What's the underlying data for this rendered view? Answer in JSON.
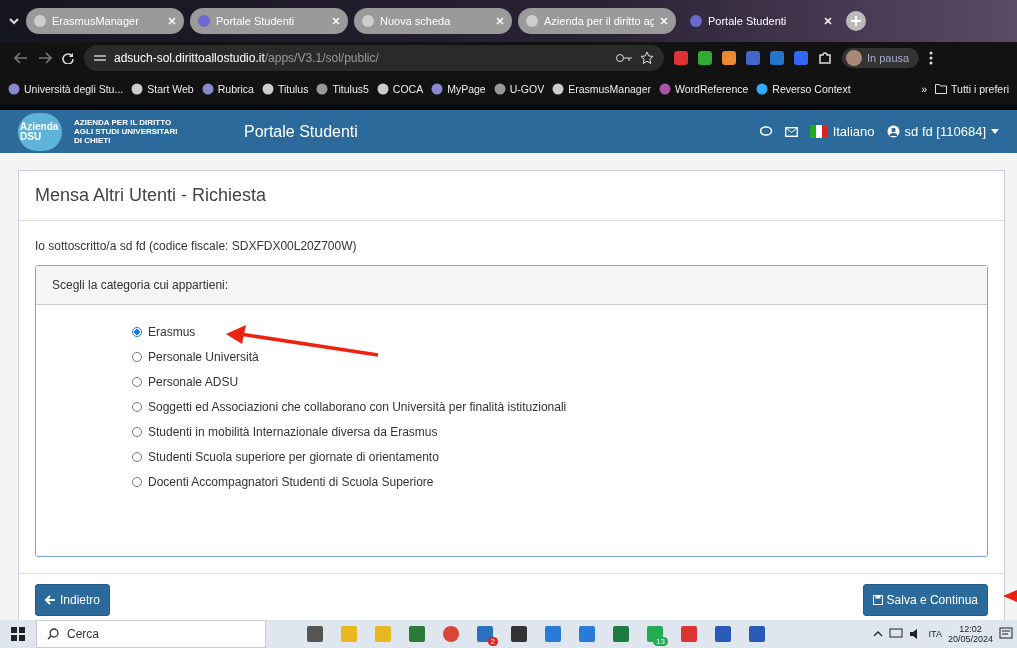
{
  "browser": {
    "tabs": [
      {
        "title": "ErasmusManager",
        "selected": false
      },
      {
        "title": "Portale Studenti",
        "selected": false
      },
      {
        "title": "Nuova scheda",
        "selected": false
      },
      {
        "title": "Azienda per il diritto ag",
        "selected": false
      },
      {
        "title": "Portale Studenti",
        "selected": true
      }
    ],
    "address": {
      "host": "adsuch-sol.dirittoallostudio.it",
      "path": "/apps/V3.1/sol/public/"
    },
    "profile": "In pausa",
    "bookmarks": [
      {
        "label": "Università degli Stu..."
      },
      {
        "label": "Start Web"
      },
      {
        "label": "Rubrica"
      },
      {
        "label": "Titulus"
      },
      {
        "label": "Titulus5"
      },
      {
        "label": "COCA"
      },
      {
        "label": "MyPage"
      },
      {
        "label": "U-GOV"
      },
      {
        "label": "ErasmusManager"
      },
      {
        "label": "WordReference"
      },
      {
        "label": "Reverso Context"
      }
    ],
    "more": "»",
    "all_bookmarks": "Tutti i preferi"
  },
  "header": {
    "logo": [
      "Azienda",
      "DSU"
    ],
    "org": [
      "AZIENDA PER IL DIRITTO",
      "AGLI STUDI UNIVERSITARI",
      "DI CHIETI"
    ],
    "title": "Portale Studenti",
    "language": "Italiano",
    "user": "sd fd [110684]"
  },
  "form": {
    "title": "Mensa Altri Utenti - Richiesta",
    "declaration": "Io sottoscritto/a sd fd (codice fiscale: SDXFDX00L20Z700W)",
    "prompt": "Scegli la categoria cui appartieni:",
    "options": [
      {
        "label": "Erasmus",
        "selected": true
      },
      {
        "label": "Personale Università",
        "selected": false
      },
      {
        "label": "Personale ADSU",
        "selected": false
      },
      {
        "label": "Soggetti ed Associazioni che collaborano con Università per finalità istituzionali",
        "selected": false
      },
      {
        "label": "Studenti in mobilità Internazionale diversa da Erasmus",
        "selected": false
      },
      {
        "label": "Studenti Scuola superiore per giornate di orientamento",
        "selected": false
      },
      {
        "label": "Docenti Accompagnatori Studenti di Scuola Superiore",
        "selected": false
      }
    ],
    "back": "Indietro",
    "save": "Salva e Continua"
  },
  "taskbar": {
    "search": "Cerca",
    "mail_badge": "2",
    "whatsapp_badge": "13",
    "language": "ITA",
    "time": "12:02",
    "date": "20/05/2024"
  }
}
